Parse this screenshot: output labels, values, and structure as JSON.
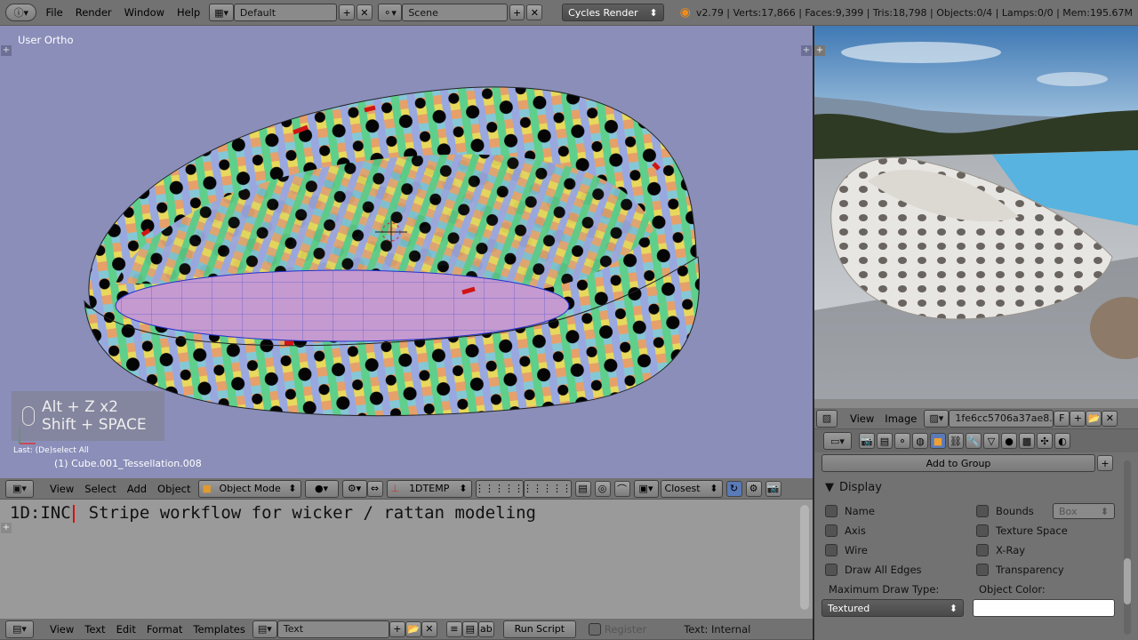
{
  "top_header": {
    "menu": [
      "File",
      "Render",
      "Window",
      "Help"
    ],
    "layout_name": "Default",
    "scene_name": "Scene",
    "render_engine": "Cycles Render",
    "stats": "v2.79 | Verts:17,866 | Faces:9,399 | Tris:18,798 | Objects:0/4 | Lamps:0/0 | Mem:195.67M"
  },
  "viewport": {
    "view_label": "User Ortho",
    "key_hint_line1": "Alt + Z x2",
    "key_hint_line2": "Shift + SPACE",
    "last_op": "Last: (De)select All",
    "object_label": "(1) Cube.001_Tessellation.008",
    "header": {
      "menu": [
        "View",
        "Select",
        "Add",
        "Object"
      ],
      "mode": "Object Mode",
      "pivot_label": "1DTEMP",
      "snap_label": "Closest"
    }
  },
  "text_editor": {
    "line": "1D:INC",
    "line_rest": "Stripe workflow for wicker / rattan modeling",
    "header": {
      "menu": [
        "View",
        "Text",
        "Edit",
        "Format",
        "Templates"
      ],
      "text_name": "Text",
      "run_script": "Run Script",
      "register": "Register",
      "status": "Text: Internal"
    }
  },
  "image_editor": {
    "menu": [
      "View",
      "Image"
    ],
    "image_name": "1fe6cc5706a37ae8...",
    "fake_user": "F"
  },
  "properties": {
    "add_to_group": "Add to Group",
    "panel_title": "Display",
    "left_checks": [
      "Name",
      "Axis",
      "Wire",
      "Draw All Edges"
    ],
    "right_checks": [
      "Bounds",
      "Texture Space",
      "X-Ray",
      "Transparency"
    ],
    "bounds_type": "Box",
    "max_draw_type_label": "Maximum Draw Type:",
    "max_draw_type_value": "Textured",
    "object_color_label": "Object Color:",
    "object_color": "#ffffff"
  },
  "colors": {
    "viewport_bg": "#8a8eb9",
    "header_bg": "#727272",
    "text_editor_bg": "#9a9a9a",
    "panel_bg": "#727272"
  }
}
